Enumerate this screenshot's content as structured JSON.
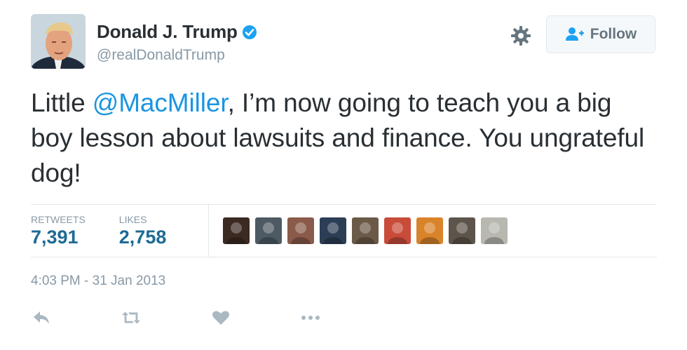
{
  "user": {
    "display_name": "Donald J. Trump",
    "handle": "@realDonaldTrump",
    "verified": true,
    "avatar_icon": "profile-photo"
  },
  "header": {
    "settings_icon": "gear-icon",
    "follow_label": "Follow",
    "follow_icon": "add-user-icon"
  },
  "tweet": {
    "text_before": "Little ",
    "mention": "@MacMiller",
    "text_after": ", I’m now going to teach you a big boy lesson about lawsuits and finance. You ungrateful dog!"
  },
  "stats": {
    "retweets_label": "RETWEETS",
    "retweets_value": "7,391",
    "likes_label": "LIKES",
    "likes_value": "2,758"
  },
  "likers": [
    {
      "color": "#3b2a22"
    },
    {
      "color": "#4d5a63"
    },
    {
      "color": "#8a5a4a"
    },
    {
      "color": "#2c3e55"
    },
    {
      "color": "#6b5a48"
    },
    {
      "color": "#c94b3a"
    },
    {
      "color": "#d9832a"
    },
    {
      "color": "#5d554b"
    },
    {
      "color": "#b8b8b0"
    }
  ],
  "meta": {
    "timestamp": "4:03 PM - 31 Jan 2013"
  },
  "actions": [
    "reply-icon",
    "retweet-icon",
    "like-icon",
    "more-icon"
  ],
  "colors": {
    "accent": "#1b95e0",
    "stat_value": "#1c6b95",
    "muted": "#8899a6",
    "icon": "#aab8c2"
  }
}
